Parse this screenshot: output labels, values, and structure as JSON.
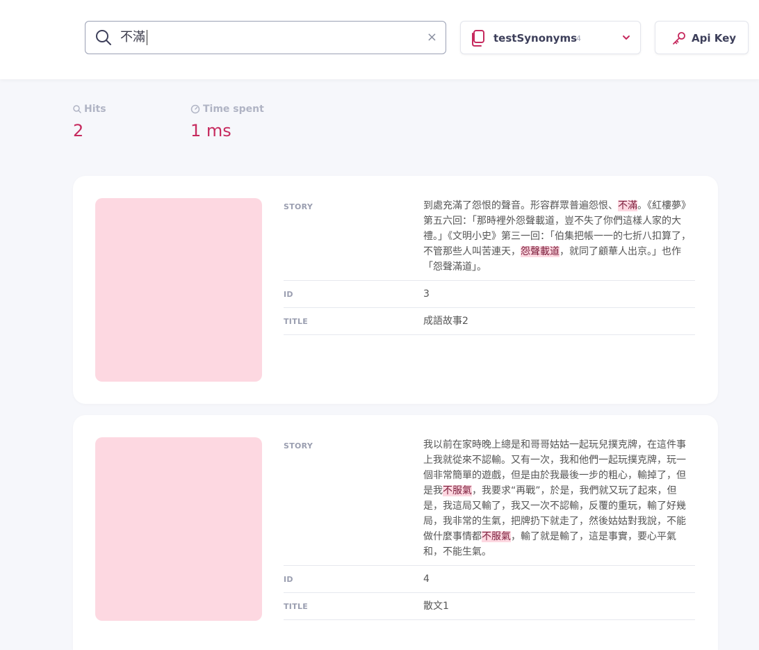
{
  "search": {
    "value": "不滿",
    "clear": "×"
  },
  "index": {
    "name": "testSynonyms",
    "count": "4"
  },
  "api_button": {
    "label": "Api Key"
  },
  "stats": {
    "hits_label": "Hits",
    "hits_value": "2",
    "time_label": "Time spent",
    "time_value": "1 ms"
  },
  "colors": {
    "accent": "#c62a5e",
    "highlight": "#fdd8e1",
    "thumb": "#fdd8e1"
  },
  "results": [
    {
      "story_label": "STORY",
      "story_parts": [
        {
          "t": "到處充滿了怨恨的聲音。形容群眾普遍怨恨、",
          "hl": false
        },
        {
          "t": "不滿",
          "hl": true
        },
        {
          "t": "。《紅樓夢》第五六回：「那時裡外怨聲載道，豈不失了你們這樣人家的大禮。」《文明小史》第三一回：「伯集把帳一一的七折八扣算了，不管那些人叫苦連天，",
          "hl": false
        },
        {
          "t": "怨聲載道",
          "hl": true
        },
        {
          "t": "，就同了顧華人出京。」也作「怨聲滿道」。",
          "hl": false
        }
      ],
      "id_label": "ID",
      "id_value": "3",
      "title_label": "TITLE",
      "title_value": "成語故事2"
    },
    {
      "story_label": "STORY",
      "story_parts": [
        {
          "t": "我以前在家時晚上總是和哥哥姑姑一起玩兒撲克牌，在這件事上我就從來不認輸。又有一次，我和他們一起玩撲克牌，玩一個非常簡單的遊戲，但是由於我最後一步的粗心，輸掉了，但是我",
          "hl": false
        },
        {
          "t": "不服氣",
          "hl": true
        },
        {
          "t": "，我要求“再戰”，於是，我們就又玩了起來，但是，我這局又輸了，我又一次不認輸，反覆的重玩，輸了好幾局，我非常的生氣，把牌扔下就走了，然後姑姑對我說，不能做什麼事情都",
          "hl": false
        },
        {
          "t": "不服氣",
          "hl": true
        },
        {
          "t": "，輸了就是輸了，這是事實，要心平氣和，不能生氣。",
          "hl": false
        }
      ],
      "id_label": "ID",
      "id_value": "4",
      "title_label": "TITLE",
      "title_value": "散文1"
    }
  ]
}
